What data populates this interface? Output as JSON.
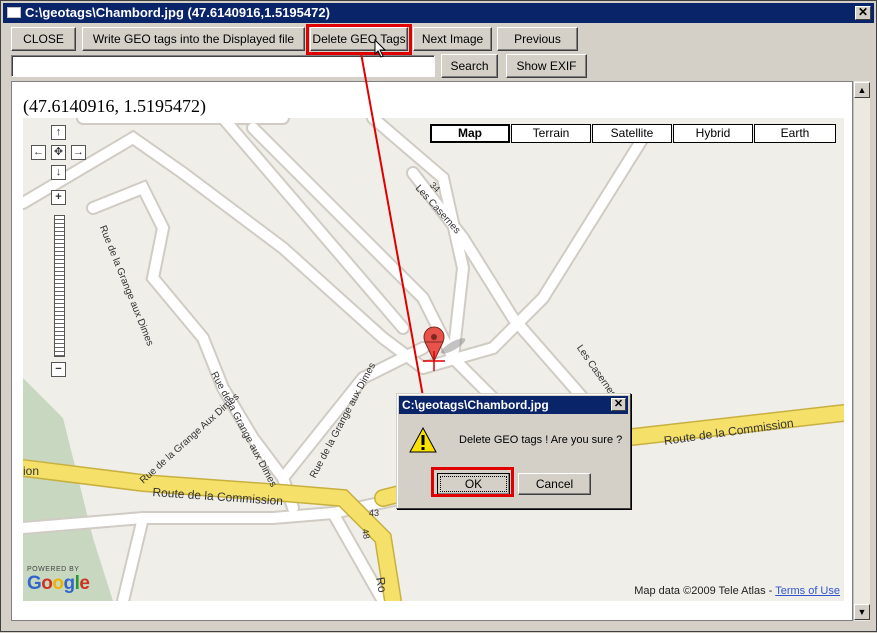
{
  "window": {
    "title": "C:\\geotags\\Chambord.jpg (47.6140916,1.5195472)",
    "close_glyph": "✕"
  },
  "toolbar": {
    "close_label": "CLOSE",
    "write_label": "Write GEO tags into the Displayed file",
    "delete_label": "Delete GEO Tags",
    "next_label": "Next Image",
    "previous_label": "Previous Image",
    "search_label": "Search",
    "show_exif_label": "Show EXIF"
  },
  "search": {
    "value": ""
  },
  "coords_display": "(47.6140916, 1.5195472)",
  "map": {
    "types": [
      "Map",
      "Terrain",
      "Satellite",
      "Hybrid",
      "Earth"
    ],
    "selected_type": "Map",
    "nav": {
      "up": "↑",
      "left": "←",
      "center": "✥",
      "right": "→",
      "down": "↓",
      "zoom_in": "+",
      "zoom_out": "−"
    },
    "labels": {
      "grange1": "Rue de la Grange aux Dimes",
      "grange2": "Rue de la Grange Aux Dimes",
      "grange3": "Rue de la Grange aux Dimes",
      "grange4": "Rue de la Grange aux Dimes",
      "casernes1": "Les Casernes",
      "casernes2": "Les Casernes",
      "commission1": "Route de la Commission",
      "commission2": "Route de la Commission",
      "commission_left": "ion",
      "road34": "34",
      "road43": "43",
      "road48": "48",
      "road_ro": "Ro"
    },
    "attribution": "Map data ©2009 Tele Atlas - ",
    "terms_link": "Terms of Use",
    "powered_by": "POWERED BY",
    "google_letters": [
      "G",
      "o",
      "o",
      "g",
      "l",
      "e"
    ]
  },
  "dialog": {
    "title": "C:\\geotags\\Chambord.jpg",
    "message": "Delete GEO tags ! Are you sure ?",
    "ok_label": "OK",
    "cancel_label": "Cancel",
    "close_glyph": "✕"
  },
  "scrollbar": {
    "up": "▲",
    "down": "▼"
  },
  "colors": {
    "highlight": "#e00000",
    "titlebar": "#0a246a",
    "marker": "#e8524a",
    "major_road": "#f5e16a"
  }
}
